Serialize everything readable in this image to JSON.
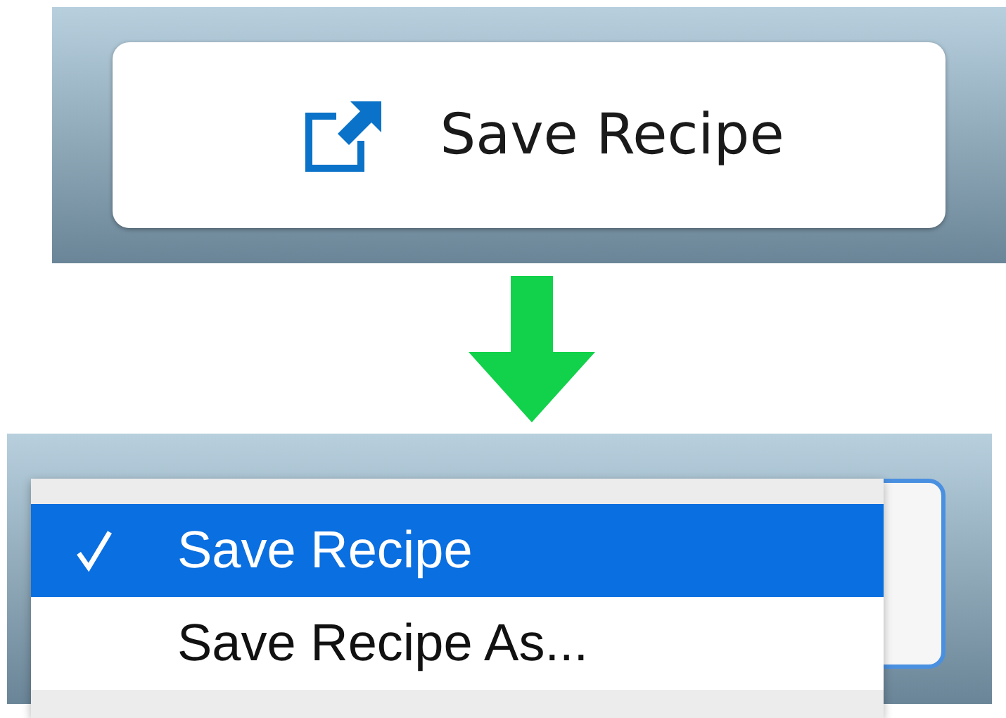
{
  "before": {
    "button": {
      "label": "Save Recipe"
    }
  },
  "after": {
    "menu": {
      "items": [
        {
          "label": "Save Recipe",
          "selected": true
        },
        {
          "label": "Save Recipe As...",
          "selected": false
        }
      ]
    }
  }
}
